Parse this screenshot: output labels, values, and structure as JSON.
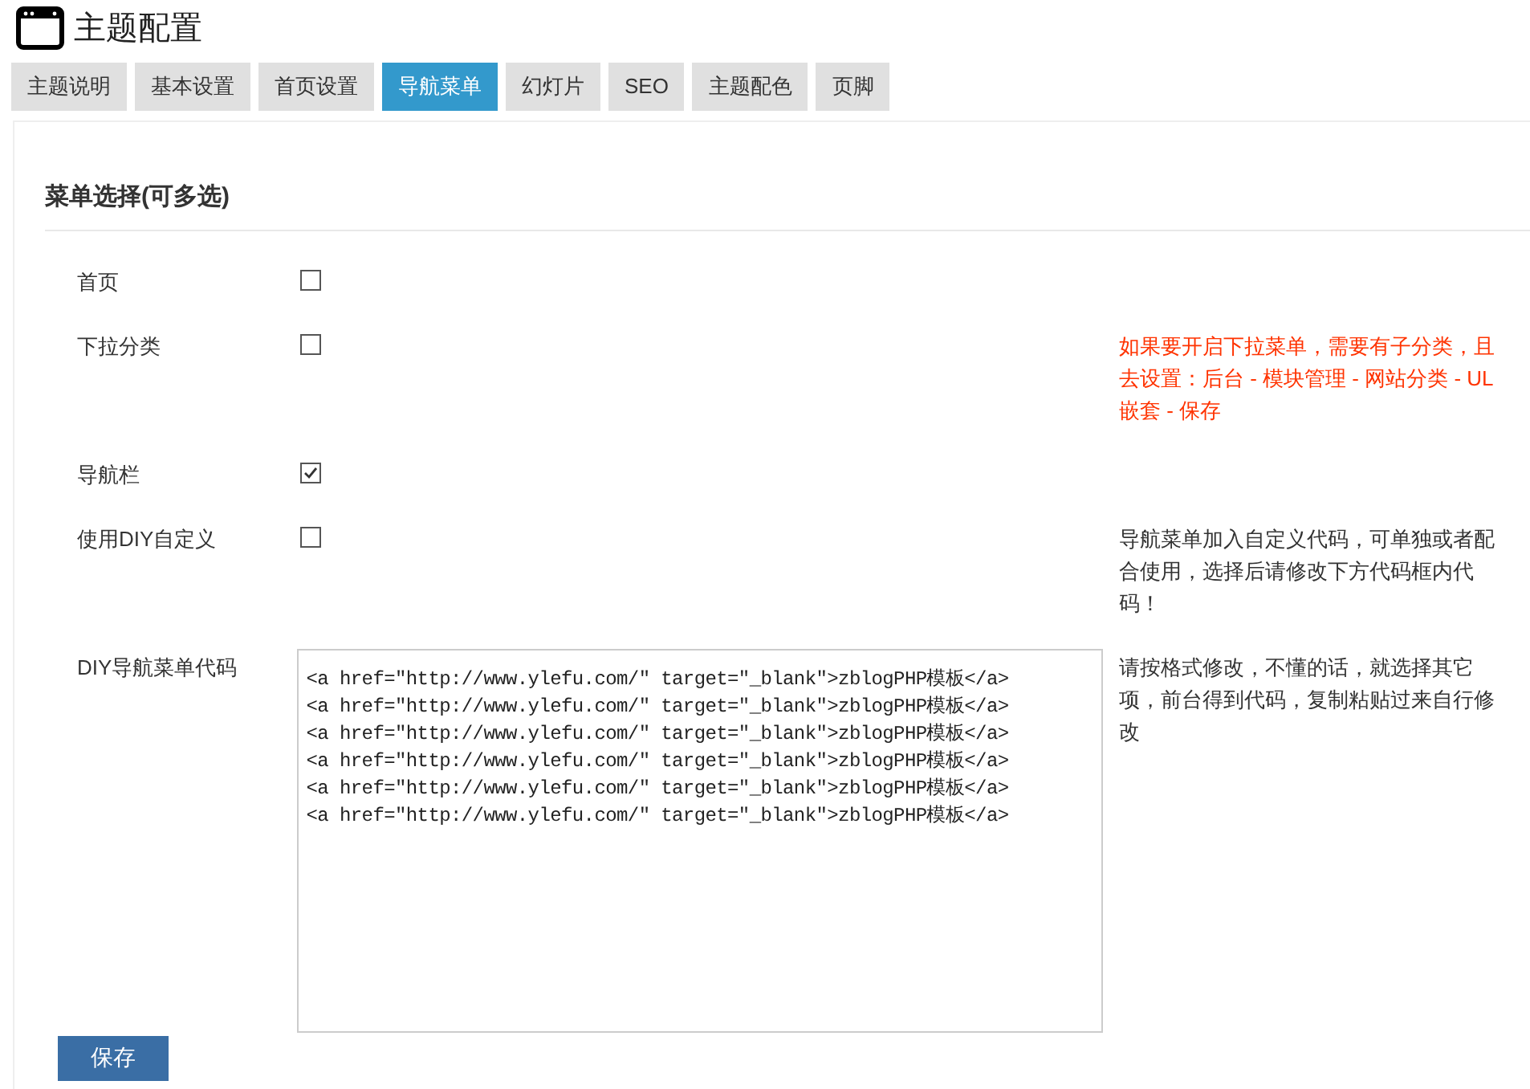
{
  "title": "主题配置",
  "tabs": [
    {
      "label": "主题说明",
      "selected": false
    },
    {
      "label": "基本设置",
      "selected": false
    },
    {
      "label": "首页设置",
      "selected": false
    },
    {
      "label": "导航菜单",
      "selected": true
    },
    {
      "label": "幻灯片",
      "selected": false
    },
    {
      "label": "SEO",
      "selected": false
    },
    {
      "label": "主题配色",
      "selected": false
    },
    {
      "label": "页脚",
      "selected": false
    }
  ],
  "section_title": "菜单选择(可多选)",
  "rows": [
    {
      "kind": "checkbox",
      "label": "首页",
      "checked": false
    },
    {
      "kind": "checkbox",
      "label": "下拉分类",
      "checked": false,
      "note_warning": true,
      "note": [
        "如果要开启下拉菜单，需要有子分类，且",
        "去设置：后台 - 模块管理 - 网站分类 - UL",
        "嵌套 - 保存"
      ]
    },
    {
      "kind": "checkbox",
      "label": "导航栏",
      "checked": true
    },
    {
      "kind": "checkbox",
      "label": "使用DIY自定义",
      "checked": false,
      "note_warning": false,
      "note": [
        "导航菜单加入自定义代码，可单独或者配",
        "合使用，选择后请修改下方代码框内代",
        "码！"
      ]
    },
    {
      "kind": "code",
      "label": "DIY导航菜单代码",
      "value": [
        "<a href=\"http://www.ylefu.com/\" target=\"_blank\">zblogPHP模板</a>",
        "<a href=\"http://www.ylefu.com/\" target=\"_blank\">zblogPHP模板</a>",
        "<a href=\"http://www.ylefu.com/\" target=\"_blank\">zblogPHP模板</a>",
        "<a href=\"http://www.ylefu.com/\" target=\"_blank\">zblogPHP模板</a>",
        "<a href=\"http://www.ylefu.com/\" target=\"_blank\">zblogPHP模板</a>",
        "<a href=\"http://www.ylefu.com/\" target=\"_blank\">zblogPHP模板</a>"
      ],
      "note_warning": false,
      "note": [
        "请按格式修改，不懂的话，就选择其它",
        "项，前台得到代码，复制粘贴过来自行修",
        "改"
      ]
    }
  ],
  "save_button": "保存"
}
